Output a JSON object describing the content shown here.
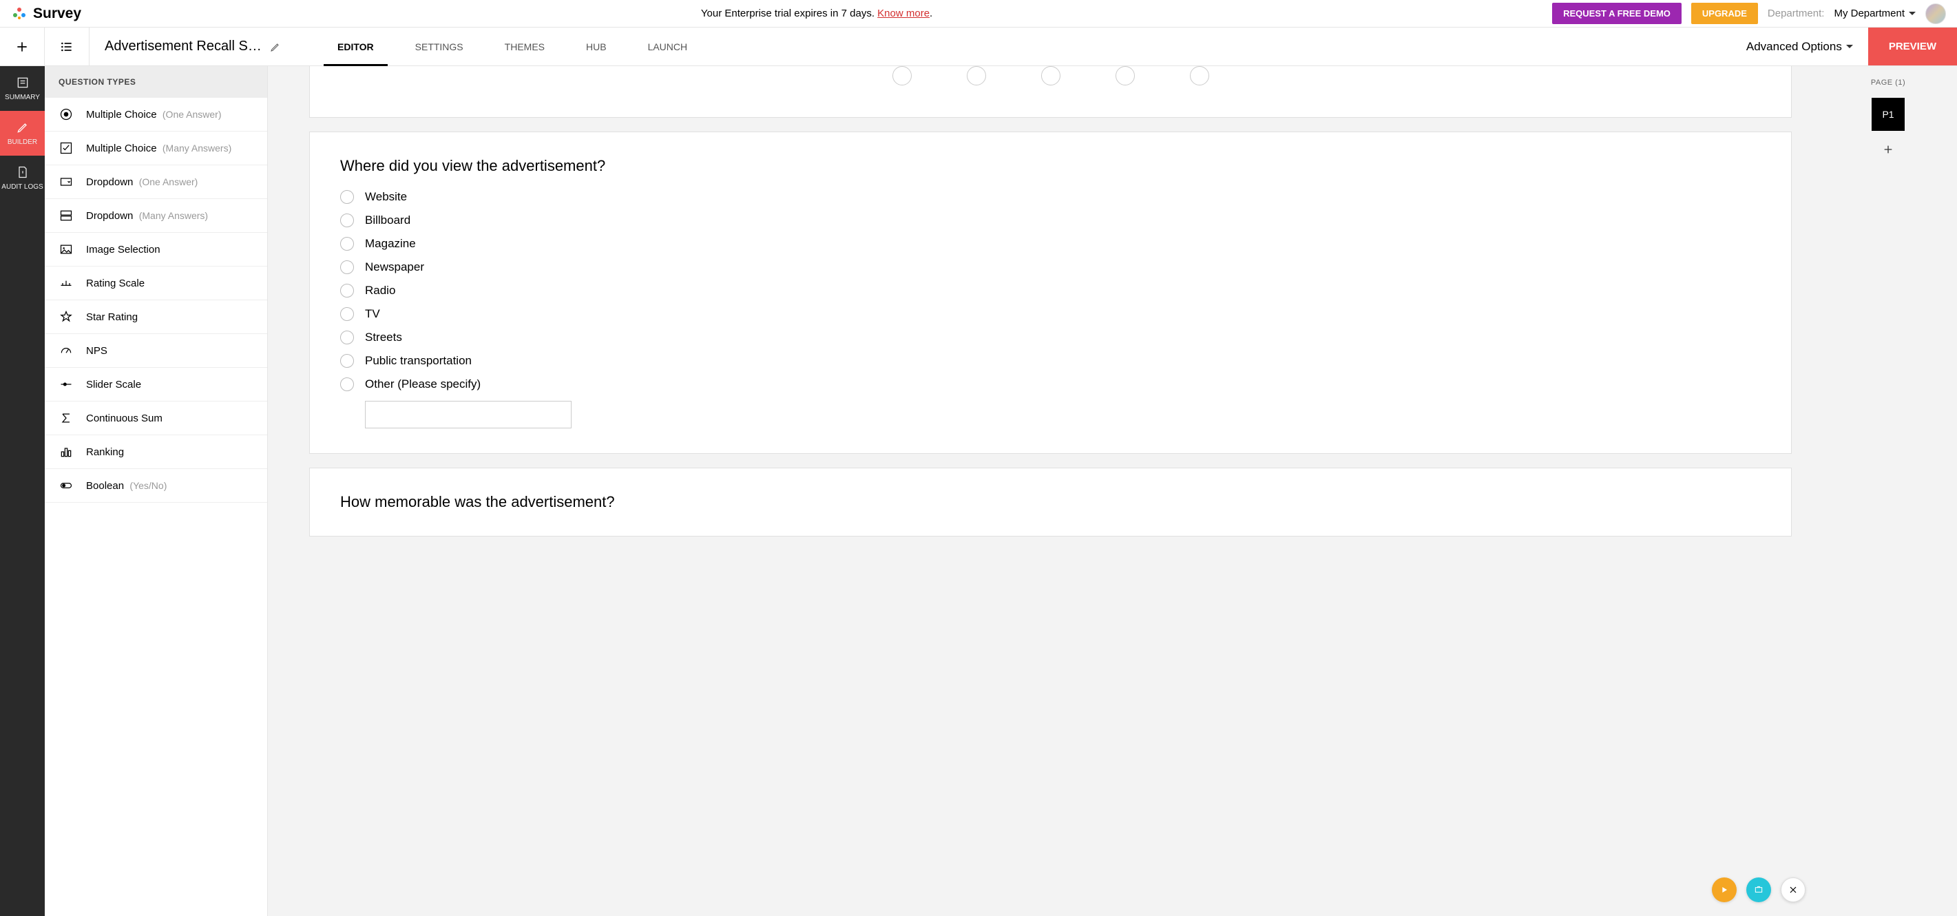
{
  "banner": {
    "brand": "Survey",
    "trial_text_prefix": "Your Enterprise trial expires in 7 days. ",
    "trial_link": "Know more",
    "trial_text_suffix": ".",
    "demo_btn": "REQUEST A FREE DEMO",
    "upgrade_btn": "UPGRADE",
    "dept_label": "Department:",
    "dept_value": "My Department"
  },
  "toolbar": {
    "survey_title": "Advertisement Recall Sur…",
    "tabs": {
      "editor": "EDITOR",
      "settings": "SETTINGS",
      "themes": "THEMES",
      "hub": "HUB",
      "launch": "LAUNCH"
    },
    "advanced": "Advanced Options",
    "preview": "PREVIEW"
  },
  "navrail": {
    "summary": "SUMMARY",
    "builder": "BUILDER",
    "audit": "AUDIT LOGS"
  },
  "qtypes": {
    "header": "QUESTION TYPES",
    "items": [
      {
        "label": "Multiple Choice",
        "sub": "(One Answer)"
      },
      {
        "label": "Multiple Choice",
        "sub": "(Many Answers)"
      },
      {
        "label": "Dropdown",
        "sub": "(One Answer)"
      },
      {
        "label": "Dropdown",
        "sub": "(Many Answers)"
      },
      {
        "label": "Image Selection",
        "sub": ""
      },
      {
        "label": "Rating Scale",
        "sub": ""
      },
      {
        "label": "Star Rating",
        "sub": ""
      },
      {
        "label": "NPS",
        "sub": ""
      },
      {
        "label": "Slider Scale",
        "sub": ""
      },
      {
        "label": "Continuous Sum",
        "sub": ""
      },
      {
        "label": "Ranking",
        "sub": ""
      },
      {
        "label": "Boolean",
        "sub": "(Yes/No)"
      }
    ]
  },
  "canvas": {
    "q1": {
      "title": "Where did you view the advertisement?",
      "choices": [
        "Website",
        "Billboard",
        "Magazine",
        "Newspaper",
        "Radio",
        "TV",
        "Streets",
        "Public transportation",
        "Other (Please specify)"
      ]
    },
    "q2": {
      "title": "How memorable was the advertisement?"
    }
  },
  "pagerail": {
    "label": "PAGE (1)",
    "thumb": "P1"
  }
}
